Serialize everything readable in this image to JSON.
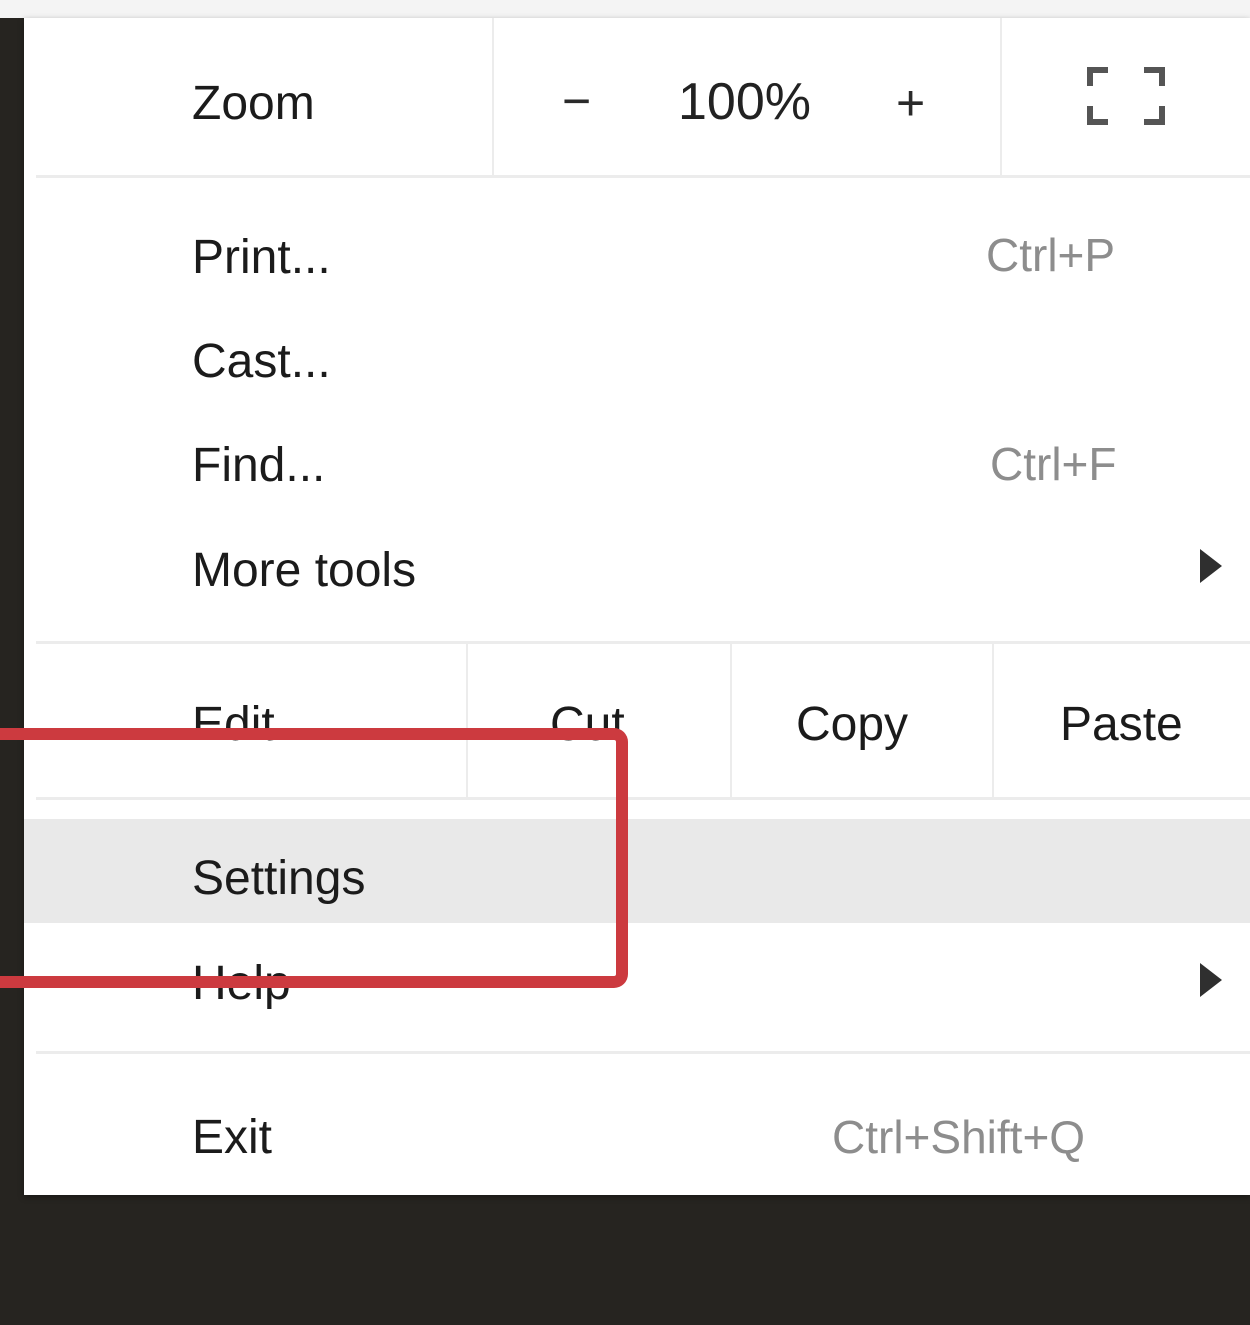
{
  "zoom": {
    "label": "Zoom",
    "decrease": "−",
    "level": "100%",
    "increase": "+"
  },
  "items": {
    "print": {
      "label": "Print...",
      "shortcut": "Ctrl+P"
    },
    "cast": {
      "label": "Cast..."
    },
    "find": {
      "label": "Find...",
      "shortcut": "Ctrl+F"
    },
    "more_tools": {
      "label": "More tools"
    },
    "settings": {
      "label": "Settings"
    },
    "help": {
      "label": "Help"
    },
    "exit": {
      "label": "Exit",
      "shortcut": "Ctrl+Shift+Q"
    }
  },
  "edit": {
    "label": "Edit",
    "cut": "Cut",
    "copy": "Copy",
    "paste": "Paste"
  },
  "colors": {
    "highlight_box": "#cc3a3f",
    "hover_row": "#e9e9e9",
    "background": "#262420"
  },
  "icons": {
    "fullscreen": "fullscreen-icon",
    "submenu": "chevron-right-icon"
  }
}
